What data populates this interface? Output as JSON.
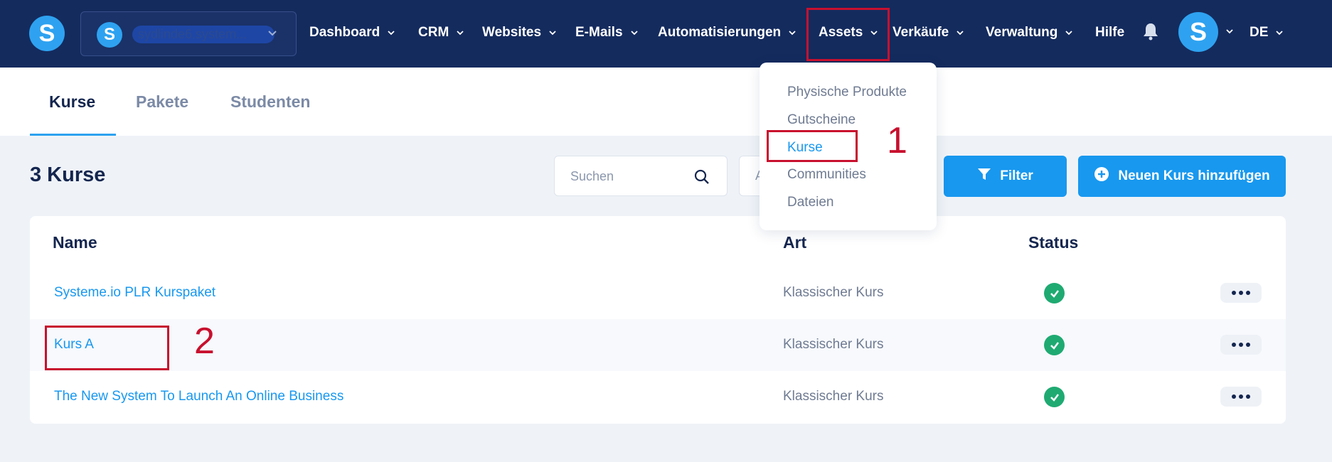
{
  "brand": {
    "logo_letter": "S"
  },
  "account": {
    "avatar_letter": "S",
    "name": "sydlinde6.system..."
  },
  "nav": {
    "items": [
      {
        "label": "Dashboard"
      },
      {
        "label": "CRM"
      },
      {
        "label": "Websites"
      },
      {
        "label": "E-Mails"
      },
      {
        "label": "Automatisierungen"
      },
      {
        "label": "Assets"
      },
      {
        "label": "Verkäufe"
      },
      {
        "label": "Verwaltung"
      },
      {
        "label": "Hilfe"
      }
    ],
    "user_avatar_letter": "S",
    "language": "DE"
  },
  "tabs": [
    {
      "label": "Kurse"
    },
    {
      "label": "Pakete"
    },
    {
      "label": "Studenten"
    }
  ],
  "toolbar": {
    "page_title": "3 Kurse",
    "search_placeholder": "Suchen",
    "second_select_partial": "A",
    "filter_label": "Filter",
    "add_label": "Neuen Kurs hinzufügen"
  },
  "assets_dropdown": {
    "items": [
      {
        "label": "Physische Produkte"
      },
      {
        "label": "Gutscheine"
      },
      {
        "label": "Kurse"
      },
      {
        "label": "Communities"
      },
      {
        "label": "Dateien"
      }
    ]
  },
  "annotations": {
    "step1": "1",
    "step2": "2"
  },
  "table": {
    "headers": {
      "name": "Name",
      "type": "Art",
      "status": "Status"
    },
    "rows": [
      {
        "name": "Systeme.io PLR Kurspaket",
        "type": "Klassischer Kurs",
        "status": "active"
      },
      {
        "name": "Kurs A",
        "type": "Klassischer Kurs",
        "status": "active"
      },
      {
        "name": "The New System To Launch An Online Business",
        "type": "Klassischer Kurs",
        "status": "active"
      }
    ]
  },
  "colors": {
    "nav_bg": "#142b5e",
    "accent": "#1898ef",
    "status_ok": "#1faa72",
    "annotation": "#c8102e"
  }
}
